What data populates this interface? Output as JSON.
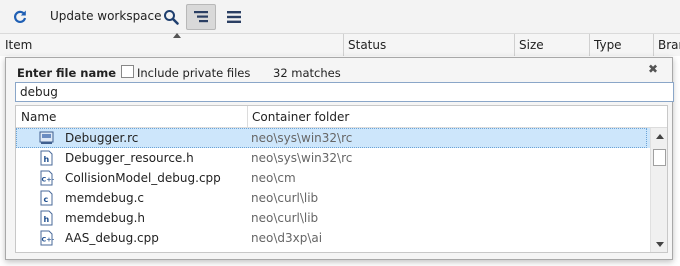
{
  "toolbar": {
    "refresh_icon": "refresh-icon",
    "update_label": "Update workspace",
    "search_icon": "search-icon",
    "tree_icon": "tree-view-icon",
    "menu_icon": "hamburger-menu-icon"
  },
  "table": {
    "columns": [
      "Item",
      "Status",
      "Size",
      "Type",
      "Bran"
    ]
  },
  "popup": {
    "title": "Enter file name",
    "include_private_label": "Include private files",
    "include_private_checked": false,
    "matches": "32 matches",
    "search_value": "debug",
    "columns": {
      "name": "Name",
      "container": "Container folder"
    },
    "rows": [
      {
        "name": "Debugger.rc",
        "folder": "neo\\sys\\win32\\rc",
        "icon": "resource-file-icon",
        "selected": true
      },
      {
        "name": "Debugger_resource.h",
        "folder": "neo\\sys\\win32\\rc",
        "icon": "header-file-icon",
        "selected": false
      },
      {
        "name": "CollisionModel_debug.cpp",
        "folder": "neo\\cm",
        "icon": "cpp-file-icon",
        "selected": false
      },
      {
        "name": "memdebug.c",
        "folder": "neo\\curl\\lib",
        "icon": "c-file-icon",
        "selected": false
      },
      {
        "name": "memdebug.h",
        "folder": "neo\\curl\\lib",
        "icon": "header-file-icon",
        "selected": false
      },
      {
        "name": "AAS_debug.cpp",
        "folder": "neo\\d3xp\\ai",
        "icon": "cpp-file-icon",
        "selected": false
      }
    ]
  },
  "colors": {
    "accent": "#1f5fb4",
    "selection": "#cde6fb"
  }
}
